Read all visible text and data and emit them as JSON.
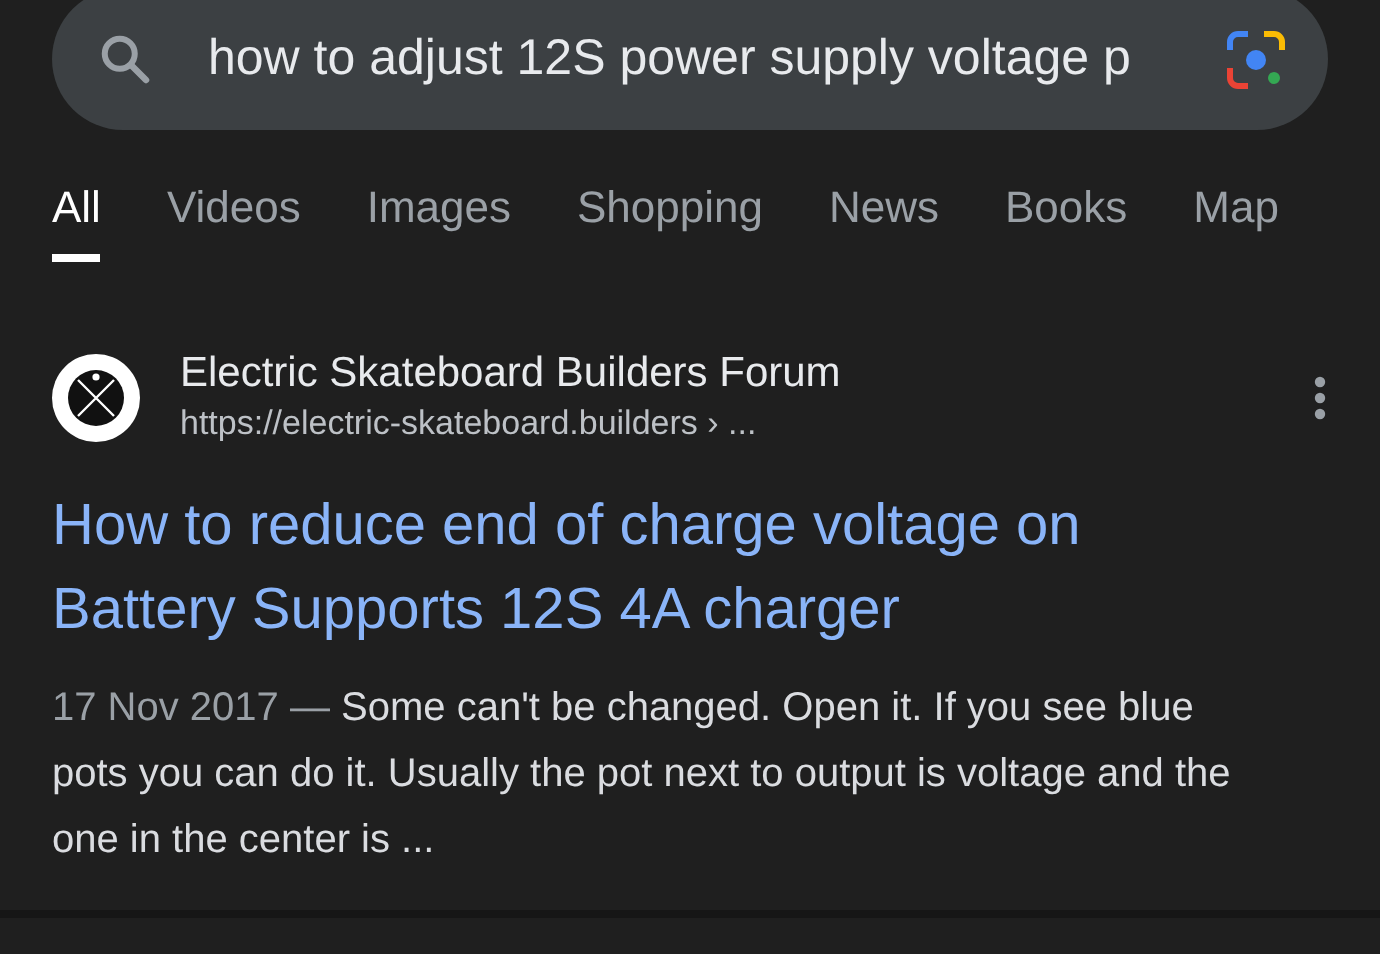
{
  "search": {
    "value": "how to adjust 12S power supply voltage p"
  },
  "tabs": [
    {
      "label": "All",
      "selected": true
    },
    {
      "label": "Videos",
      "selected": false
    },
    {
      "label": "Images",
      "selected": false
    },
    {
      "label": "Shopping",
      "selected": false
    },
    {
      "label": "News",
      "selected": false
    },
    {
      "label": "Books",
      "selected": false
    },
    {
      "label": "Map",
      "selected": false
    }
  ],
  "result": {
    "site": "Electric Skateboard Builders Forum",
    "url": "https://electric-skateboard.builders › ...",
    "title": "How to reduce end of charge voltage on Battery Supports 12S 4A charger",
    "date": "17 Nov 2017 — ",
    "snippet": "Some can't be changed. Open it. If you see blue pots you can do it. Usually the pot next to output is voltage and the one in the center is ..."
  }
}
